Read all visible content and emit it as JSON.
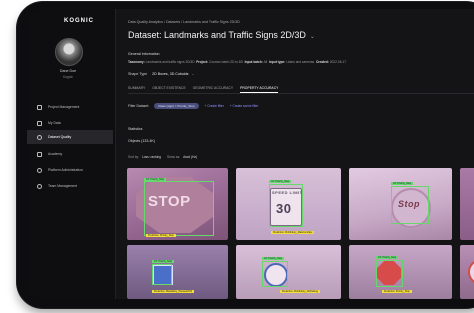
{
  "app": {
    "logo": "KOGNIC"
  },
  "user": {
    "name": "Dane Doe",
    "org": "Kognic"
  },
  "sidebar": {
    "items": [
      {
        "label": "Project Management",
        "icon": "folder-icon"
      },
      {
        "label": "My Data",
        "icon": "data-icon"
      },
      {
        "label": "Dataset Quality",
        "icon": "quality-icon"
      },
      {
        "label": "Academy",
        "icon": "academy-icon"
      },
      {
        "label": "Platform Administration",
        "icon": "globe-icon"
      },
      {
        "label": "Team Management",
        "icon": "team-icon"
      }
    ]
  },
  "breadcrumb": "Data Quality Analytics / Datasets / Landmarks and Traffic Signs 2D/3D",
  "page_title": "Dataset: Landmarks and Traffic Signs 2D/3D",
  "general": {
    "heading": "General information",
    "taxonomy_label": "Taxonomy:",
    "taxonomy_value": "Landmarks and traffic signs 2D/3D",
    "project_label": "Project:",
    "project_value": "Cosmos batch 2D to 6D",
    "batch_label": "Input batch:",
    "batch_value": "All",
    "type_label": "Input type:",
    "type_value": "Lidars and cameras",
    "created_label": "Created:",
    "created_value": "2022-06-17"
  },
  "scope": {
    "label": "Shape Type",
    "value": "2D Boxes, 3D Cuboids"
  },
  "tabs": [
    "SUMMARY",
    "OBJECT EXISTENCE",
    "GEOMETRIC ACCURACY",
    "PROPERTY ACCURACY"
  ],
  "filter": {
    "label": "Filter Dataset:",
    "chip": "Class (sign) = Priority_Stop",
    "create_filter": "+ Create filter",
    "create_scene_filter": "+ Create scene filter"
  },
  "statistics_heading": "Statistics",
  "objects_heading": "Objects (133.4K)",
  "sort": {
    "label": "Sort by:",
    "value": "Loss: ranking",
    "show_label": "Show as:",
    "show_value": "Ascd (Hz)"
  },
  "grid": {
    "gt_labels": [
      "GT: Priority_Stop",
      "GT: Priority_Stop",
      "GT: Priority_Stop",
      "GT: Priority_Stop",
      "GT: Priority_Stop",
      "GT: Priority_Stop"
    ],
    "pred_labels": [
      "Prediction: Priority_Stop",
      "Prediction: Prohibitory_MaximumSpe",
      "Prediction: Mandatory_PassLeftOrS",
      "Prediction: Prohibitory_NoParking",
      "Prediction: Priority_Stop"
    ],
    "sign_texts": [
      "STOP",
      "SPEED LIMIT",
      "30",
      "Stop"
    ]
  },
  "colors": {
    "accent": "#8f93ff",
    "gt": "#67d86a",
    "prediction": "#f4dc3a"
  }
}
